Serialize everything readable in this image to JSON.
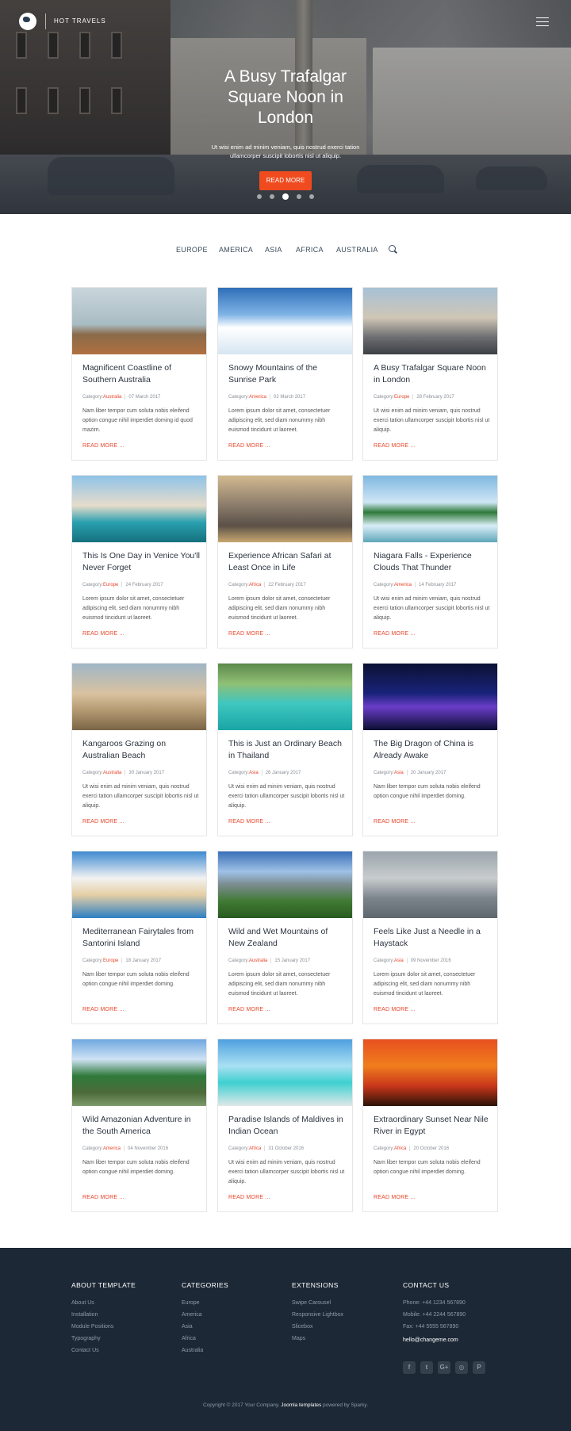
{
  "header": {
    "brand": "HOT TRAVELS"
  },
  "hero": {
    "title": "A Busy Trafalgar Square Noon in London",
    "text": "Ut wisi enim ad minim veniam, quis nostrud exerci tation ullamcorper suscipit lobortis nisl ut aliquip.",
    "button": "READ MORE"
  },
  "nav": {
    "items": [
      "EUROPE",
      "AMERICA",
      "ASIA",
      "AFRICA",
      "AUSTRALIA"
    ]
  },
  "cards": [
    {
      "title": "Magnificent Coastline of Southern Australia",
      "category_label": "Category:",
      "category": "Australia",
      "date": "07 March 2017",
      "excerpt": "Nam liber tempor cum soluta nobis eleifend option congue nihil imperdiet doming id quod mazim.",
      "more": "READ MORE ..."
    },
    {
      "title": "Snowy Mountains of the Sunrise Park",
      "category_label": "Category:",
      "category": "America",
      "date": "02 March 2017",
      "excerpt": "Lorem ipsum dolor sit amet, consectetuer adipiscing elit, sed diam nonummy nibh euismod tincidunt ut laoreet.",
      "more": "READ MORE ..."
    },
    {
      "title": "A Busy Trafalgar Square Noon in London",
      "category_label": "Category:",
      "category": "Europe",
      "date": "28 February 2017",
      "excerpt": "Ut wisi enim ad minim veniam, quis nostrud exerci tation ullamcorper suscipit lobortis nisl ut aliquip.",
      "more": "READ MORE ..."
    },
    {
      "title": "This Is One Day in Venice You'll Never Forget",
      "category_label": "Category:",
      "category": "Europe",
      "date": "24 February 2017",
      "excerpt": "Lorem ipsum dolor sit amet, consectetuer adipiscing elit, sed diam nonummy nibh euismod tincidunt ut laoreet.",
      "more": "READ MORE ..."
    },
    {
      "title": "Experience African Safari at Least Once in Life",
      "category_label": "Category:",
      "category": "Africa",
      "date": "22 February 2017",
      "excerpt": "Lorem ipsum dolor sit amet, consectetuer adipiscing elit, sed diam nonummy nibh euismod tincidunt ut laoreet.",
      "more": "READ MORE ..."
    },
    {
      "title": "Niagara Falls - Experience Clouds That Thunder",
      "category_label": "Category:",
      "category": "America",
      "date": "14 February 2017",
      "excerpt": "Ut wisi enim ad minim veniam, quis nostrud exerci tation ullamcorper suscipit lobortis nisl ut aliquip.",
      "more": "READ MORE ..."
    },
    {
      "title": "Kangaroos Grazing on Australian Beach",
      "category_label": "Category:",
      "category": "Australia",
      "date": "30 January 2017",
      "excerpt": "Ut wisi enim ad minim veniam, quis nostrud exerci tation ullamcorper suscipit lobortis nisl ut aliquip.",
      "more": "READ MORE ..."
    },
    {
      "title": "This is Just an Ordinary Beach in Thailand",
      "category_label": "Category:",
      "category": "Asia",
      "date": "26 January 2017",
      "excerpt": "Ut wisi enim ad minim veniam, quis nostrud exerci tation ullamcorper suscipit lobortis nisl ut aliquip.",
      "more": "READ MORE ..."
    },
    {
      "title": "The Big Dragon of China is Already Awake",
      "category_label": "Category:",
      "category": "Asia",
      "date": "20 January 2017",
      "excerpt": "Nam liber tempor cum soluta nobis eleifend option congue nihil imperdiet doming.",
      "more": "READ MORE ..."
    },
    {
      "title": "Mediterranean Fairytales from Santorini Island",
      "category_label": "Category:",
      "category": "Europe",
      "date": "18 January 2017",
      "excerpt": "Nam liber tempor cum soluta nobis eleifend option congue nihil imperdiet doming.",
      "more": "READ MORE ..."
    },
    {
      "title": "Wild and Wet Mountains of New Zealand",
      "category_label": "Category:",
      "category": "Australia",
      "date": "15 January 2017",
      "excerpt": "Lorem ipsum dolor sit amet, consectetuer adipiscing elit, sed diam nonummy nibh euismod tincidunt ut laoreet.",
      "more": "READ MORE ..."
    },
    {
      "title": "Feels Like Just a Needle in a Haystack",
      "category_label": "Category:",
      "category": "Asia",
      "date": "09 November 2016",
      "excerpt": "Lorem ipsum dolor sit amet, consectetuer adipiscing elit, sed diam nonummy nibh euismod tincidunt ut laoreet.",
      "more": "READ MORE ..."
    },
    {
      "title": "Wild Amazonian Adventure in the South America",
      "category_label": "Category:",
      "category": "America",
      "date": "04 November 2016",
      "excerpt": "Nam liber tempor cum soluta nobis eleifend option congue nihil imperdiet doming.",
      "more": "READ MORE ..."
    },
    {
      "title": "Paradise Islands of Maldives in Indian Ocean",
      "category_label": "Category:",
      "category": "Africa",
      "date": "31 October 2016",
      "excerpt": "Ut wisi enim ad minim veniam, quis nostrud exerci tation ullamcorper suscipit lobortis nisl ut aliquip.",
      "more": "READ MORE ..."
    },
    {
      "title": "Extraordinary Sunset Near Nile River in Egypt",
      "category_label": "Category:",
      "category": "Africa",
      "date": "20 October 2016",
      "excerpt": "Nam liber tempor cum soluta nobis eleifend option congue nihil imperdiet doming.",
      "more": "READ MORE ..."
    }
  ],
  "footer": {
    "about": {
      "heading": "ABOUT TEMPLATE",
      "links": [
        "About Us",
        "Installation",
        "Module Positions",
        "Typography",
        "Contact Us"
      ]
    },
    "categories": {
      "heading": "CATEGORIES",
      "links": [
        "Europe",
        "America",
        "Asia",
        "Africa",
        "Australia"
      ]
    },
    "extensions": {
      "heading": "EXTENSIONS",
      "links": [
        "Swipe Carousel",
        "Responsive Lightbox",
        "Slicebox",
        "Maps"
      ]
    },
    "contact": {
      "heading": "CONTACT US",
      "phone": "Phone: +44 1234 567890",
      "mobile": "Mobile: +44 2244 567890",
      "fax": "Fax: +44 5555 567890",
      "email": "hello@changeme.com"
    },
    "socials": [
      {
        "icon": "facebook-icon",
        "glyph": "f"
      },
      {
        "icon": "twitter-icon",
        "glyph": "t"
      },
      {
        "icon": "google-plus-icon",
        "glyph": "G+"
      },
      {
        "icon": "instagram-icon",
        "glyph": "◎"
      },
      {
        "icon": "pinterest-icon",
        "glyph": "P"
      }
    ],
    "copyright_pre": "Copyright © 2017 Your Company.",
    "copyright_link": "Joomla templates",
    "copyright_post": "powered by Sparky."
  },
  "colors": {
    "accent": "#f04b1f",
    "footer_bg": "#1c2836",
    "nav_text": "#3b4b5d"
  }
}
